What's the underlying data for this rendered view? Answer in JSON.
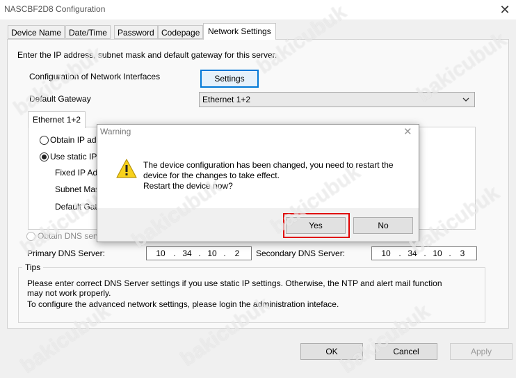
{
  "window": {
    "title": "NASCBF2D8 Configuration",
    "close_glyph": "✕"
  },
  "tabs": [
    {
      "label": "Device Name"
    },
    {
      "label": "Date/Time"
    },
    {
      "label": "Password"
    },
    {
      "label": "Codepage"
    },
    {
      "label": "Network Settings"
    }
  ],
  "network": {
    "intro": "Enter the IP address, subnet mask and default gateway for this server.",
    "config_label": "Configuration of Network Interfaces",
    "settings_button": "Settings",
    "gateway_label": "Default Gateway",
    "gateway_value": "Ethernet 1+2",
    "subtab": "Ethernet 1+2",
    "obtain_ip": "Obtain IP ad",
    "use_static": "Use static IP",
    "fixed_ip": "Fixed IP Ad",
    "subnet": "Subnet Mas",
    "default_gat": "Default Gat",
    "obtain_dns": "Obtain DNS serv",
    "primary_dns_label": "Primary DNS Server:",
    "primary_dns": [
      "10",
      "34",
      "10",
      "2"
    ],
    "secondary_dns_label": "Secondary DNS Server:",
    "secondary_dns": [
      "10",
      "34",
      "10",
      "3"
    ]
  },
  "tips": {
    "label": "Tips",
    "line1": "Please enter correct DNS Server settings if you use static IP settings.  Otherwise, the NTP and alert mail function",
    "line2": "may not work properly.",
    "line3": "To configure the advanced network settings, please login the administration inteface."
  },
  "footer": {
    "ok": "OK",
    "cancel": "Cancel",
    "apply": "Apply"
  },
  "watermark": "bakicubuk",
  "dialog": {
    "title": "Warning",
    "line1": "The device configuration has been changed, you need to restart the",
    "line2": "device for the changes to take effect.",
    "line3": "Restart the device now?",
    "yes": "Yes",
    "no": "No",
    "highlight_color": "#e00000"
  },
  "colors": {
    "accent": "#0078d7",
    "warning_yellow": "#f8d21c"
  }
}
